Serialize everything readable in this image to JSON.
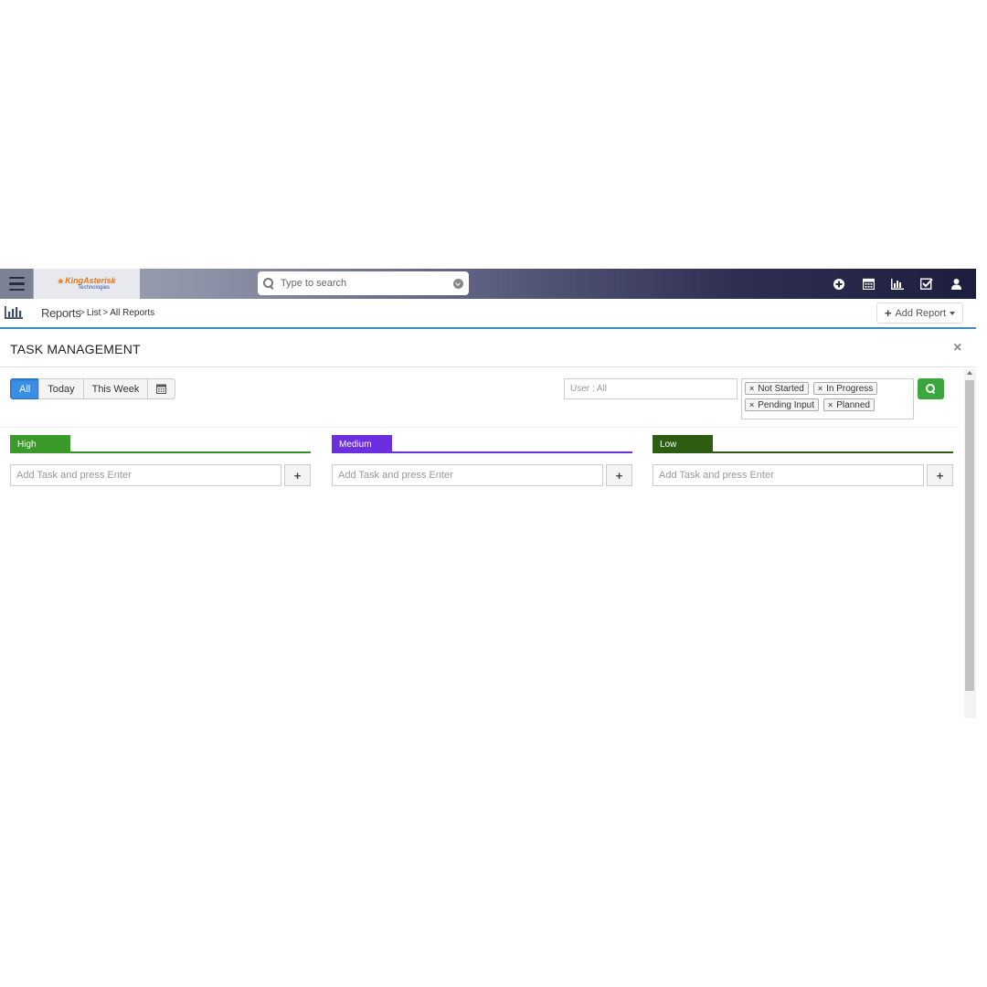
{
  "navbar": {
    "logo_mark": "*",
    "logo_line1": "KingAsterisk",
    "logo_line2": "Technologies",
    "search_placeholder": "Type to search",
    "icons": [
      "plus-circle-icon",
      "calendar-icon",
      "bar-chart-icon",
      "check-square-icon",
      "user-icon"
    ]
  },
  "breadcrumb": {
    "title": "Reports",
    "items": [
      "List",
      "All Reports"
    ],
    "separator": ">",
    "add_report_label": "Add Report",
    "add_report_plus": "+"
  },
  "panel": {
    "title": "TASK MANAGEMENT",
    "close_label": "×"
  },
  "filters": {
    "segments": [
      "All",
      "Today",
      "This Week"
    ],
    "active_segment": "All",
    "user_placeholder": "User : All",
    "status_tags": [
      "Not Started",
      "In Progress",
      "Pending Input",
      "Planned"
    ],
    "tag_remove": "×"
  },
  "columns": [
    {
      "label": "High",
      "color": "#3a9a2a",
      "line_color": "#2f8f2f",
      "input_placeholder": "Add Task and press Enter",
      "add_label": "+"
    },
    {
      "label": "Medium",
      "color": "#6b2fe0",
      "line_color": "#6b2fe0",
      "input_placeholder": "Add Task and press Enter",
      "add_label": "+"
    },
    {
      "label": "Low",
      "color": "#2e5c12",
      "line_color": "#2e5c12",
      "input_placeholder": "Add Task and press Enter",
      "add_label": "+"
    }
  ],
  "colors": {
    "accent_blue": "#3a8ee6",
    "search_green": "#3aa63d",
    "crumb_border": "#3c8dbc"
  }
}
